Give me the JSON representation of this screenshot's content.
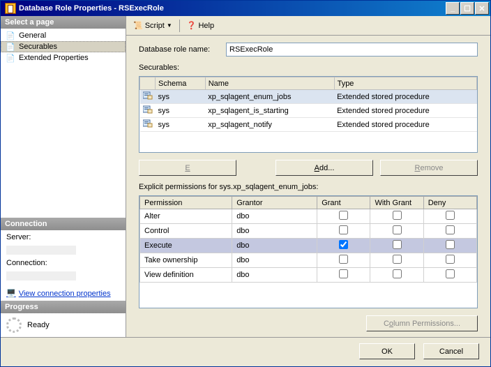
{
  "window": {
    "title": "Database Role Properties - RSExecRole"
  },
  "winbtns": {
    "min": "_",
    "max": "☐",
    "close": "✕"
  },
  "left": {
    "select_page": "Select a page",
    "nav": {
      "general": "General",
      "securables": "Securables",
      "extended": "Extended Properties"
    },
    "connection_hdr": "Connection",
    "server_lbl": "Server:",
    "conn_lbl": "Connection:",
    "view_conn": "View connection properties",
    "progress_hdr": "Progress",
    "ready": "Ready"
  },
  "toolbar": {
    "script": "Script",
    "help": "Help"
  },
  "main": {
    "role_name_lbl": "Database role name:",
    "role_name_val": "RSExecRole",
    "securables_lbl": "Securables:",
    "grid_headers": {
      "schema": "Schema",
      "name": "Name",
      "type": "Type"
    },
    "rows": [
      {
        "schema": "sys",
        "name": "xp_sqlagent_enum_jobs",
        "type": "Extended stored procedure"
      },
      {
        "schema": "sys",
        "name": "xp_sqlagent_is_starting",
        "type": "Extended stored procedure"
      },
      {
        "schema": "sys",
        "name": "xp_sqlagent_notify",
        "type": "Extended stored procedure"
      }
    ],
    "eff_perm": "Effective Permissions...",
    "add": "Add...",
    "remove": "Remove",
    "explicit_lbl": "Explicit permissions for sys.xp_sqlagent_enum_jobs:",
    "perm_headers": {
      "permission": "Permission",
      "grantor": "Grantor",
      "grant": "Grant",
      "withgrant": "With Grant",
      "deny": "Deny"
    },
    "perms": [
      {
        "permission": "Alter",
        "grantor": "dbo",
        "grant": false,
        "withgrant": false,
        "deny": false,
        "hl": false
      },
      {
        "permission": "Control",
        "grantor": "dbo",
        "grant": false,
        "withgrant": false,
        "deny": false,
        "hl": false
      },
      {
        "permission": "Execute",
        "grantor": "dbo",
        "grant": true,
        "withgrant": false,
        "deny": false,
        "hl": true
      },
      {
        "permission": "Take ownership",
        "grantor": "dbo",
        "grant": false,
        "withgrant": false,
        "deny": false,
        "hl": false
      },
      {
        "permission": "View definition",
        "grantor": "dbo",
        "grant": false,
        "withgrant": false,
        "deny": false,
        "hl": false
      }
    ],
    "col_perm": "Column Permissions..."
  },
  "footer": {
    "ok": "OK",
    "cancel": "Cancel"
  }
}
